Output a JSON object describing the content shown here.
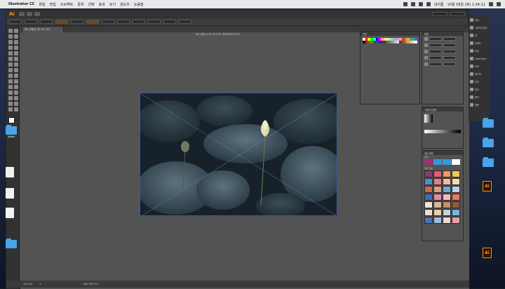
{
  "menubar": {
    "app_name": "Illustrator CC",
    "items": [
      "파일",
      "편집",
      "오브젝트",
      "문자",
      "선택",
      "효과",
      "보기",
      "윈도우",
      "도움말"
    ],
    "clock": "10월 16일 (화) 1:34:11",
    "user": "내이름"
  },
  "toolbar_app": {
    "logo": "Ai"
  },
  "document": {
    "tab_label": "6N_연꽃.ai @ 16.13%",
    "artboard_title": "6N_연꽃.ai @ 16.13% (RGB/미리 보기)",
    "zoom": "16.13%",
    "artboard_index": "1",
    "status_text": "대지 선택 도구"
  },
  "panels": {
    "swatches": {
      "title": "견본"
    },
    "transform": {
      "title": "변형"
    },
    "gradient": {
      "title": "그레이디언트"
    },
    "color_themes": {
      "title": "색상 테마",
      "sub_a": "주요",
      "sub_b": "색상 견본"
    }
  },
  "right_dock": {
    "items": [
      "색상",
      "그레이디언트",
      "획",
      "투명도",
      "모양",
      "OpenType",
      "단락",
      "레이어",
      "대지",
      "링크",
      "문자",
      "변형"
    ]
  },
  "desktop_icons": [
    {
      "label": "Adobe",
      "kind": "folder"
    },
    {
      "label": "",
      "kind": "file"
    },
    {
      "label": "",
      "kind": "file"
    },
    {
      "label": "",
      "kind": "file"
    },
    {
      "label": "",
      "kind": "folder"
    },
    {
      "label": "",
      "kind": "folder"
    },
    {
      "label": "",
      "kind": "folder"
    },
    {
      "label": "",
      "kind": "folder"
    },
    {
      "label": "",
      "kind": "ai"
    },
    {
      "label": "",
      "kind": "ai"
    }
  ],
  "colors": {
    "accent": "#ff9a00",
    "selection": "#3a5aa8",
    "swatch_grid": [
      [
        "#ffffff",
        "#ff0000",
        "#ffff00",
        "#00ff00",
        "#00ffff",
        "#0000ff",
        "#ff00ff",
        "#f2a0a0",
        "#f8d08a",
        "#f0f08a",
        "#b8e08a",
        "#8ad0c8",
        "#8ab0e0",
        "#c8a0d8",
        "#e0a0c0",
        "#c04040",
        "#e08a30",
        "#c0c040",
        "#60a040",
        "#40a0a0",
        "#4070c0"
      ],
      [
        "#000000",
        "#8a3030",
        "#8a6020",
        "#808020",
        "#306030",
        "#206060",
        "#203880",
        "#602060",
        "#404040",
        "#606060",
        "#808080",
        "#a0a0a0",
        "#c0c0c0",
        "#d8d8d8",
        "#703820",
        "#a05028",
        "#c07838",
        "#d8a060",
        "#e8c898",
        "#f0e0c8",
        "#ffffff"
      ]
    ],
    "theme_row": [
      "#a03070",
      "#3898d8",
      "#3898d8",
      "#ffffff"
    ],
    "library_swatches": [
      [
        "#8a3d6a",
        "#e25a7a",
        "#f39a5a",
        "#f2c84b"
      ],
      [
        "#4f8fd1",
        "#e87f7f",
        "#f5b9a6",
        "#f4d9b5"
      ],
      [
        "#c86a4a",
        "#d4a17a",
        "#6ea9d8",
        "#b3d6ee"
      ],
      [
        "#3e6fb5",
        "#e58ba2",
        "#f2b9c7",
        "#ee7a55"
      ],
      [
        "#f3e5d8",
        "#d9b89c",
        "#c98d6a",
        "#8d5a3d"
      ],
      [
        "#eadfc8",
        "#f2c9a8",
        "#b7d6e8",
        "#79b4dc"
      ],
      [
        "#4b74b0",
        "#9bbde0",
        "#f0d7d0",
        "#e8a1a1"
      ]
    ]
  }
}
